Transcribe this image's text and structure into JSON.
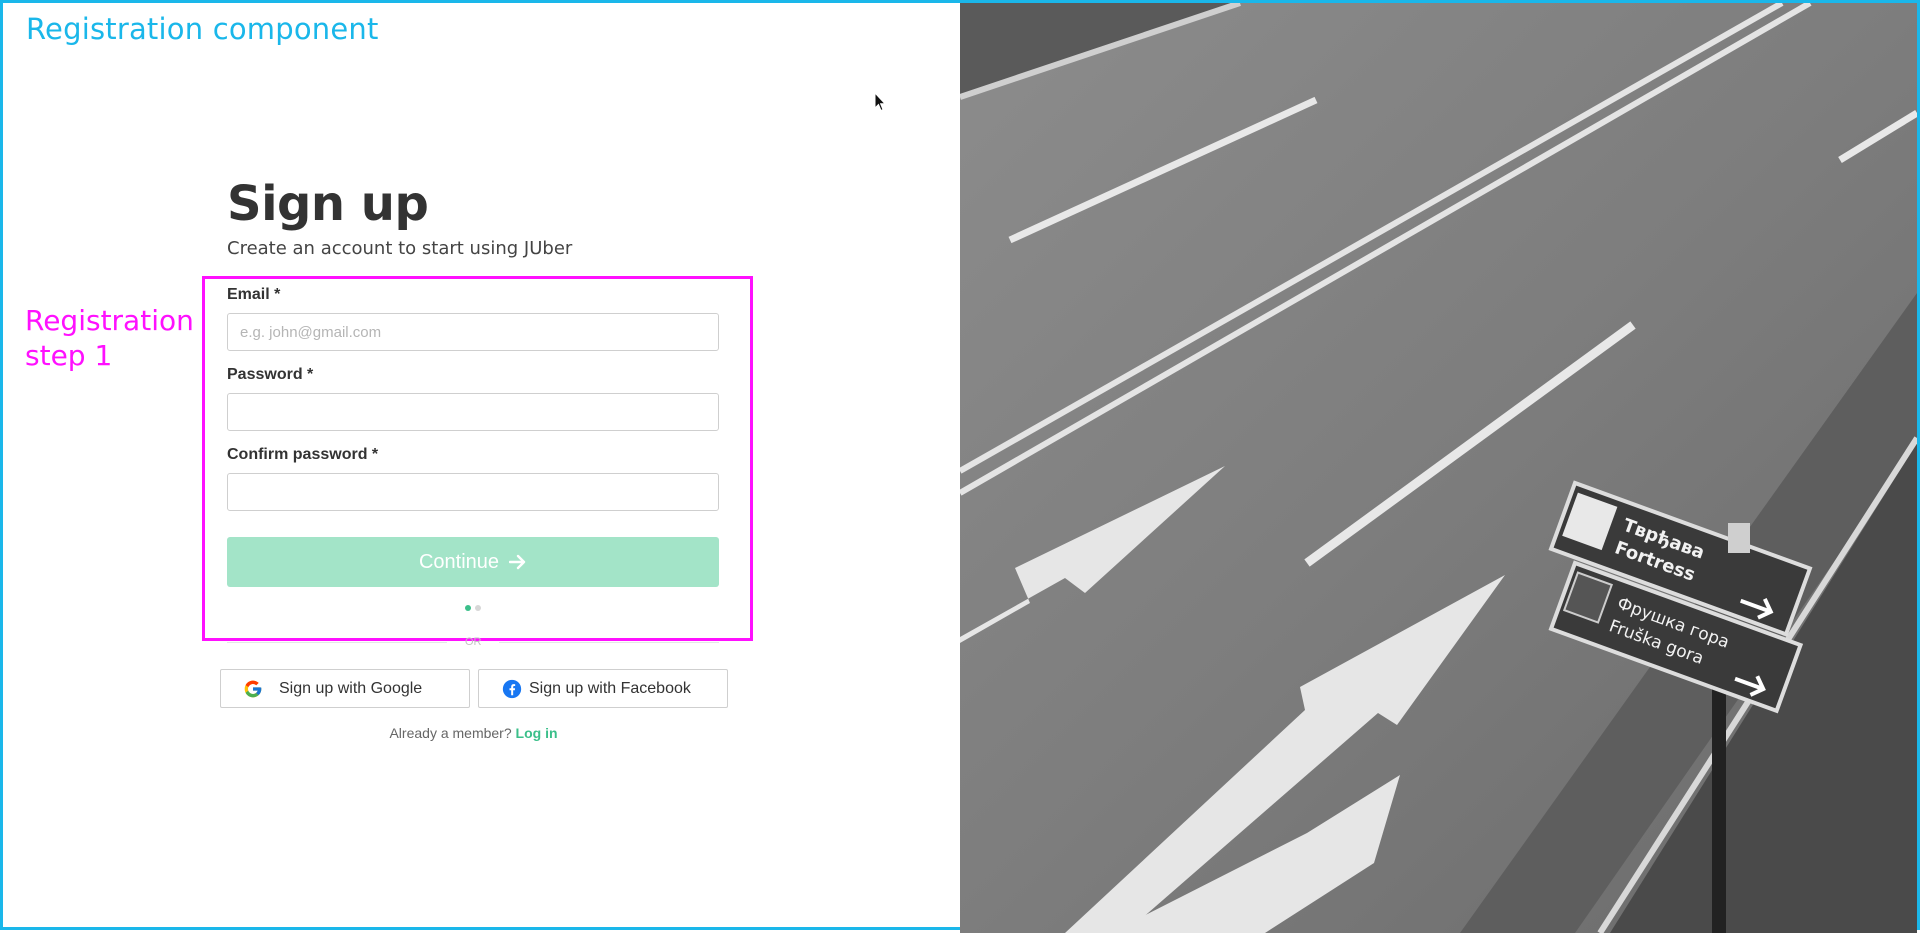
{
  "annotations": {
    "title": "Registration component",
    "step_line1": "Registration",
    "step_line2": "step 1"
  },
  "signup": {
    "heading": "Sign up",
    "subtitle": "Create an account to start using JUber"
  },
  "form": {
    "email_label": "Email *",
    "email_placeholder": "e.g. john@gmail.com",
    "email_value": "",
    "password_label": "Password *",
    "password_value": "",
    "confirm_label": "Confirm password *",
    "confirm_value": "",
    "continue_label": "Continue",
    "steps_total": 2,
    "step_current": 1
  },
  "divider": {
    "text": "OR"
  },
  "social": {
    "google_label": "Sign up with Google",
    "facebook_label": "Sign up with Facebook"
  },
  "footer": {
    "already_text": "Already a member?",
    "login_label": "Log in"
  },
  "photo_signs": {
    "sign1_line1": "Тврђава",
    "sign1_line2": "Fortress",
    "sign2_line1": "Фрушка гора",
    "sign2_line2": "Fruška gora"
  },
  "colors": {
    "annotation_blue": "#1ab7ea",
    "annotation_magenta": "#ff10ff",
    "accent_green": "#3bbf8a",
    "button_disabled": "#a3e4c8"
  },
  "icons": [
    "arrow-right-icon",
    "google-icon",
    "facebook-icon",
    "castle-icon",
    "leaf-icon",
    "cursor-icon"
  ]
}
